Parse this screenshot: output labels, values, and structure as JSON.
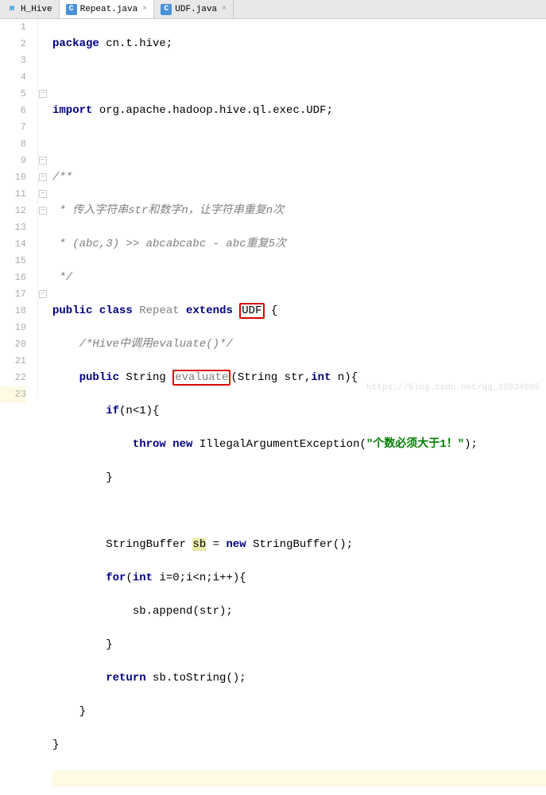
{
  "tabs": [
    {
      "icon": "m",
      "label": "H_Hive"
    },
    {
      "icon": "c",
      "label": "Repeat.java"
    },
    {
      "icon": "c",
      "label": "UDF.java"
    }
  ],
  "lines": [
    "1",
    "2",
    "3",
    "4",
    "5",
    "6",
    "7",
    "8",
    "9",
    "10",
    "11",
    "12",
    "13",
    "14",
    "15",
    "16",
    "17",
    "18",
    "19",
    "20",
    "21",
    "22",
    "23"
  ],
  "code": {
    "l1_kw": "package",
    "l1_rest": " cn.t.hive;",
    "l3_kw": "import",
    "l3_rest": " org.apache.hadoop.hive.ql.exec.UDF;",
    "l5": "/**",
    "l6a": " * 传入字符串str和数字n，让字符串重复n次",
    "l7a": " * (abc,3) >> abcabcabc - abc重复5次",
    "l8": " */",
    "l9_public": "public ",
    "l9_class": "class ",
    "l9_name": "Repeat",
    "l9_extends": " extends ",
    "l9_udf": "UDF",
    "l9_brace": " {",
    "l10_cmt": "/*Hive中调用evaluate()*/",
    "l11_public": "public ",
    "l11_string": "String ",
    "l11_eval": "evaluate",
    "l11_lparen": "(",
    "l11_str2": "String str,",
    "l11_int": "int",
    "l11_rest": " n){",
    "l12_if": "if",
    "l12_rest": "(n<1){",
    "l13_throw": "throw",
    "l13_new": " new",
    "l13_ex": " IllegalArgumentException(",
    "l13_str": "\"个数必须大于1！\"",
    "l13_end": ");",
    "l14": "}",
    "l16_sb": "StringBuffer ",
    "l16_var": "sb",
    "l16_eq": " = ",
    "l16_new": "new",
    "l16_rest": " StringBuffer();",
    "l17_for": "for",
    "l17_p": "(",
    "l17_int": "int",
    "l17_rest": " i=0;i<n;i++){",
    "l18": "sb.append(str);",
    "l19": "}",
    "l20_ret": "return",
    "l20_rest": " sb.toString();",
    "l21": "}",
    "l22": "}"
  },
  "watermark": "https://blog.csdn.net/qq_32834005"
}
